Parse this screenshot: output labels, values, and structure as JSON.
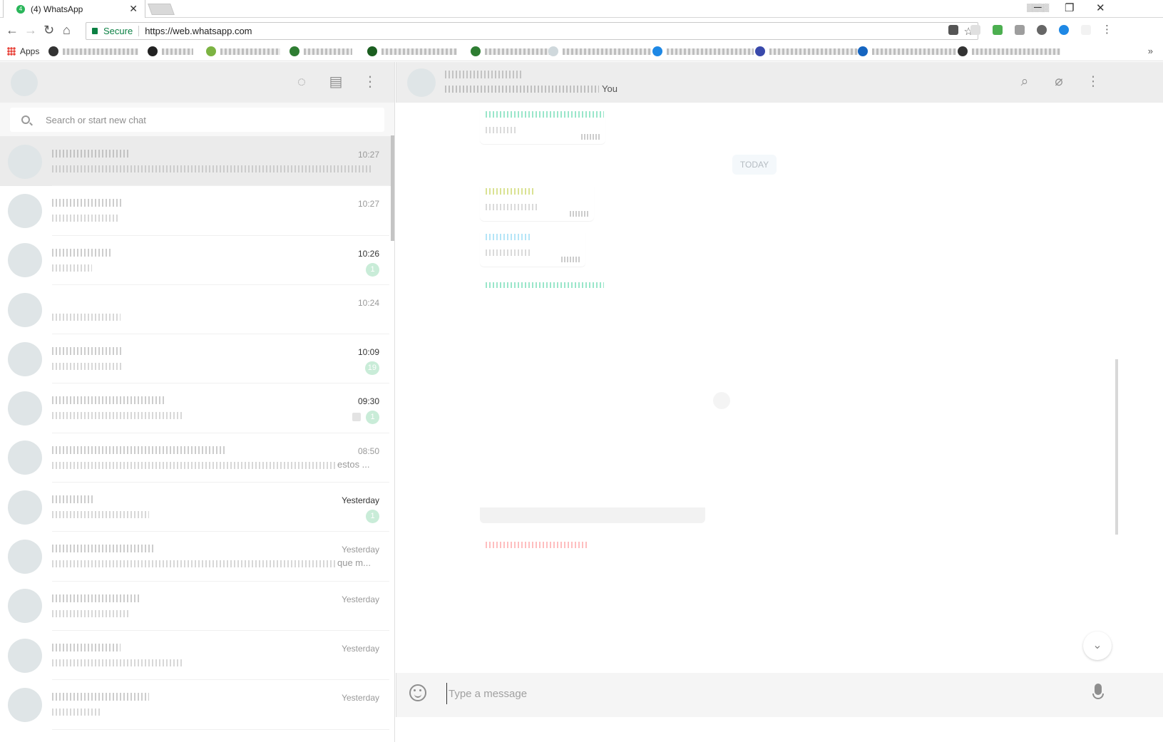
{
  "browser": {
    "tab_title": "(4) WhatsApp",
    "tab_favicon_badge": "4",
    "secure_label": "Secure",
    "url": "https://web.whatsapp.com",
    "apps_label": "Apps",
    "window_controls": [
      "minimize-icon",
      "restore-icon",
      "close-icon"
    ]
  },
  "sidebar": {
    "search_placeholder": "Search or start new chat",
    "header_icons": [
      "status-icon",
      "new-chat-icon",
      "menu-dots-icon"
    ],
    "chats": [
      {
        "time": "10:27",
        "bold": false,
        "badge": "",
        "active": true,
        "name_w": 110,
        "preview_w": 448,
        "tail": ""
      },
      {
        "time": "10:27",
        "bold": false,
        "badge": "",
        "active": false,
        "name_w": 98,
        "preview_w": 92,
        "tail": ""
      },
      {
        "time": "10:26",
        "bold": true,
        "badge": "1",
        "active": false,
        "name_w": 82,
        "preview_w": 56,
        "tail": ""
      },
      {
        "time": "10:24",
        "bold": false,
        "badge": "",
        "active": false,
        "name_w": 0,
        "preview_w": 96,
        "tail": ""
      },
      {
        "time": "10:09",
        "bold": true,
        "badge": "19",
        "active": false,
        "name_w": 98,
        "preview_w": 100,
        "tail": ""
      },
      {
        "time": "09:30",
        "bold": true,
        "badge": "1",
        "active": false,
        "name_w": 160,
        "preview_w": 184,
        "tail": "",
        "muted": true
      },
      {
        "time": "08:50",
        "bold": false,
        "badge": "",
        "active": false,
        "name_w": 244,
        "preview_w": 400,
        "tail": "estos ..."
      },
      {
        "time": "Yesterday",
        "bold": true,
        "badge": "1",
        "active": false,
        "name_w": 58,
        "preview_w": 136,
        "tail": ""
      },
      {
        "time": "Yesterday",
        "bold": false,
        "badge": "",
        "active": false,
        "name_w": 142,
        "preview_w": 400,
        "tail": "que m..."
      },
      {
        "time": "Yesterday",
        "bold": false,
        "badge": "",
        "active": false,
        "name_w": 124,
        "preview_w": 108,
        "tail": ""
      },
      {
        "time": "Yesterday",
        "bold": false,
        "badge": "",
        "active": false,
        "name_w": 96,
        "preview_w": 182,
        "tail": ""
      },
      {
        "time": "Yesterday",
        "bold": false,
        "badge": "",
        "active": false,
        "name_w": 136,
        "preview_w": 70,
        "tail": ""
      }
    ]
  },
  "conversation": {
    "members_suffix": "You",
    "date_separator": "TODAY",
    "compose_placeholder": "Type a message",
    "header_icons": [
      "search-icon",
      "attach-icon",
      "menu-dots-icon"
    ],
    "sender_colors": [
      "#35cd96",
      "#b4c427",
      "#6bcbef",
      "#35cd96",
      "#fe7c7f"
    ]
  }
}
